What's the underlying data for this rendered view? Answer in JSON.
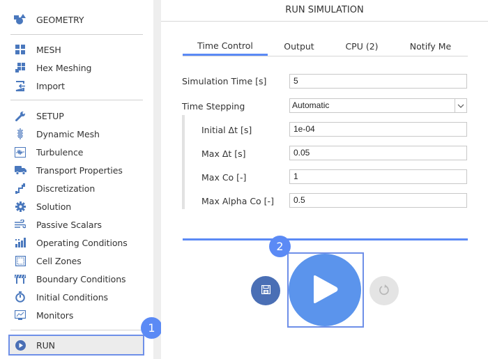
{
  "sidebar": {
    "items": [
      {
        "id": "geometry",
        "label": "GEOMETRY",
        "icon": "shapes-icon"
      },
      {
        "id": "mesh",
        "label": "MESH",
        "icon": "grid-icon"
      },
      {
        "id": "hex-meshing",
        "label": "Hex Meshing",
        "icon": "hex-grid-icon"
      },
      {
        "id": "import",
        "label": "Import",
        "icon": "import-icon"
      },
      {
        "id": "setup",
        "label": "SETUP",
        "icon": "wrench-icon"
      },
      {
        "id": "dynamic-mesh",
        "label": "Dynamic Mesh",
        "icon": "spring-icon"
      },
      {
        "id": "turbulence",
        "label": "Turbulence",
        "icon": "waveform-icon"
      },
      {
        "id": "transport-properties",
        "label": "Transport Properties",
        "icon": "truck-icon"
      },
      {
        "id": "discretization",
        "label": "Discretization",
        "icon": "discretization-icon"
      },
      {
        "id": "solution",
        "label": "Solution",
        "icon": "gear-icon"
      },
      {
        "id": "passive-scalars",
        "label": "Passive Scalars",
        "icon": "wind-icon"
      },
      {
        "id": "operating-conditions",
        "label": "Operating Conditions",
        "icon": "bar-chart-icon"
      },
      {
        "id": "cell-zones",
        "label": "Cell Zones",
        "icon": "cell-zone-icon"
      },
      {
        "id": "boundary-conditions",
        "label": "Boundary Conditions",
        "icon": "barrier-icon"
      },
      {
        "id": "initial-conditions",
        "label": "Initial Conditions",
        "icon": "stopwatch-icon"
      },
      {
        "id": "monitors",
        "label": "Monitors",
        "icon": "monitor-icon"
      },
      {
        "id": "run",
        "label": "RUN",
        "icon": "play-circle-icon",
        "selected": true
      }
    ]
  },
  "badges": {
    "one": "1",
    "two": "2"
  },
  "main": {
    "title": "RUN SIMULATION",
    "tabs": [
      {
        "label": "Time Control",
        "active": true
      },
      {
        "label": "Output",
        "active": false
      },
      {
        "label": "CPU  (2)",
        "active": false
      },
      {
        "label": "Notify Me",
        "active": false
      }
    ],
    "form": {
      "simulation_time": {
        "label": "Simulation Time [s]",
        "value": "5"
      },
      "time_stepping": {
        "label": "Time Stepping",
        "value": "Automatic"
      },
      "initial_dt": {
        "label": "Initial Δt [s]",
        "value": "1e-04"
      },
      "max_dt": {
        "label": "Max Δt [s]",
        "value": "0.05"
      },
      "max_co": {
        "label": "Max Co [-]",
        "value": "1"
      },
      "max_alpha_co": {
        "label": "Max Alpha Co [-]",
        "value": "0.5"
      }
    },
    "actions": {
      "save": "save-icon",
      "play": "play-icon",
      "reset": "reset-icon"
    }
  },
  "colors": {
    "accent": "#5b8af5",
    "icon_blue": "#4a78bd",
    "play_blue": "#5b94ec",
    "save_blue": "#4a6fb5",
    "disabled_gray": "#e4e4e4"
  }
}
